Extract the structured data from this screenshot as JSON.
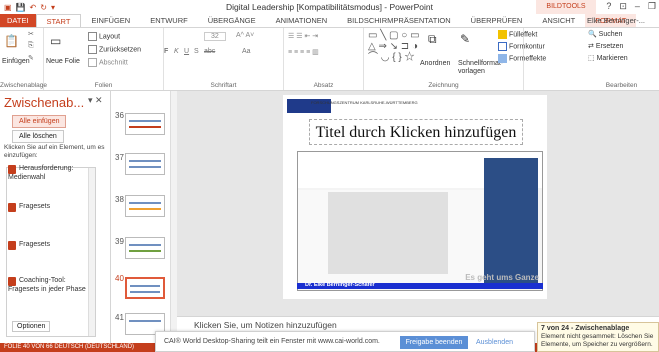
{
  "window": {
    "title": "Digital Leadership [Kompatibilitätsmodus] - PowerPoint",
    "contextual_tab": "BILDTOOLS",
    "user": "Elke Berninger-...",
    "help": "?"
  },
  "tabs": [
    "DATEI",
    "START",
    "EINFÜGEN",
    "ENTWURF",
    "ÜBERGÄNGE",
    "ANIMATIONEN",
    "BILDSCHIRMPRÄSENTATION",
    "ÜBERPRÜFEN",
    "ANSICHT",
    "FORMAT"
  ],
  "ribbon": {
    "clipboard": {
      "label": "Zwischenablage",
      "paste": "Einfügen"
    },
    "slides": {
      "label": "Folien",
      "new": "Neue Folie",
      "layout": "Layout",
      "reset": "Zurücksetzen",
      "section": "Abschnitt"
    },
    "font": {
      "label": "Schriftart",
      "size": "32",
      "bold": "F",
      "italic": "K",
      "underline": "U",
      "strike": "S",
      "spacing": "abc",
      "aa": "Aa"
    },
    "paragraph": {
      "label": "Absatz"
    },
    "drawing": {
      "label": "Zeichnung",
      "arrange": "Anordnen",
      "quickstyles": "Schnellformat-vorlagen",
      "fill": "Fülleffekt",
      "outline": "Formkontur",
      "effects": "Formeffekte"
    },
    "editing": {
      "label": "Bearbeiten",
      "find": "Suchen",
      "replace": "Ersetzen",
      "select": "Markieren"
    }
  },
  "clipboard_pane": {
    "title": "Zwischenab...",
    "paste_all": "Alle einfügen",
    "clear_all": "Alle löschen",
    "hint": "Klicken Sie auf ein Element, um es einzufügen:",
    "items": [
      "Herausforderung: Medienwahl",
      "Fragesets",
      "Fragesets",
      "Coaching-Tool: Fragesets in jeder Phase"
    ],
    "options": "Optionen"
  },
  "thumbnails": [
    {
      "num": "36",
      "selected": false
    },
    {
      "num": "37",
      "selected": false
    },
    {
      "num": "38",
      "selected": false
    },
    {
      "num": "39",
      "selected": false
    },
    {
      "num": "40",
      "selected": true
    },
    {
      "num": "41",
      "selected": false
    }
  ],
  "slide": {
    "title_placeholder": "Titel durch Klicken hinzufügen",
    "author": "Dr. Elke Berninger-Schäfer",
    "motto": "Es geht ums Ganze",
    "logo": "FORSCHUNGSZENTRUM KARLSRUHE-WÜRTTEMBERG"
  },
  "notes_placeholder": "Klicken Sie, um Notizen hinzuzufügen",
  "status": "FOLIE 40 VON 66    DEUTSCH (DEUTSCHLAND)",
  "share_bar": {
    "text": "CAI® World Desktop-Sharing teilt ein Fenster mit www.cai-world.com.",
    "stop": "Freigabe beenden",
    "hide": "Ausblenden"
  },
  "toast": {
    "title": "7 von 24 - Zwischenablage",
    "body": "Element nicht gesammelt: Löschen Sie Elemente, um Speicher zu vergrößern."
  }
}
